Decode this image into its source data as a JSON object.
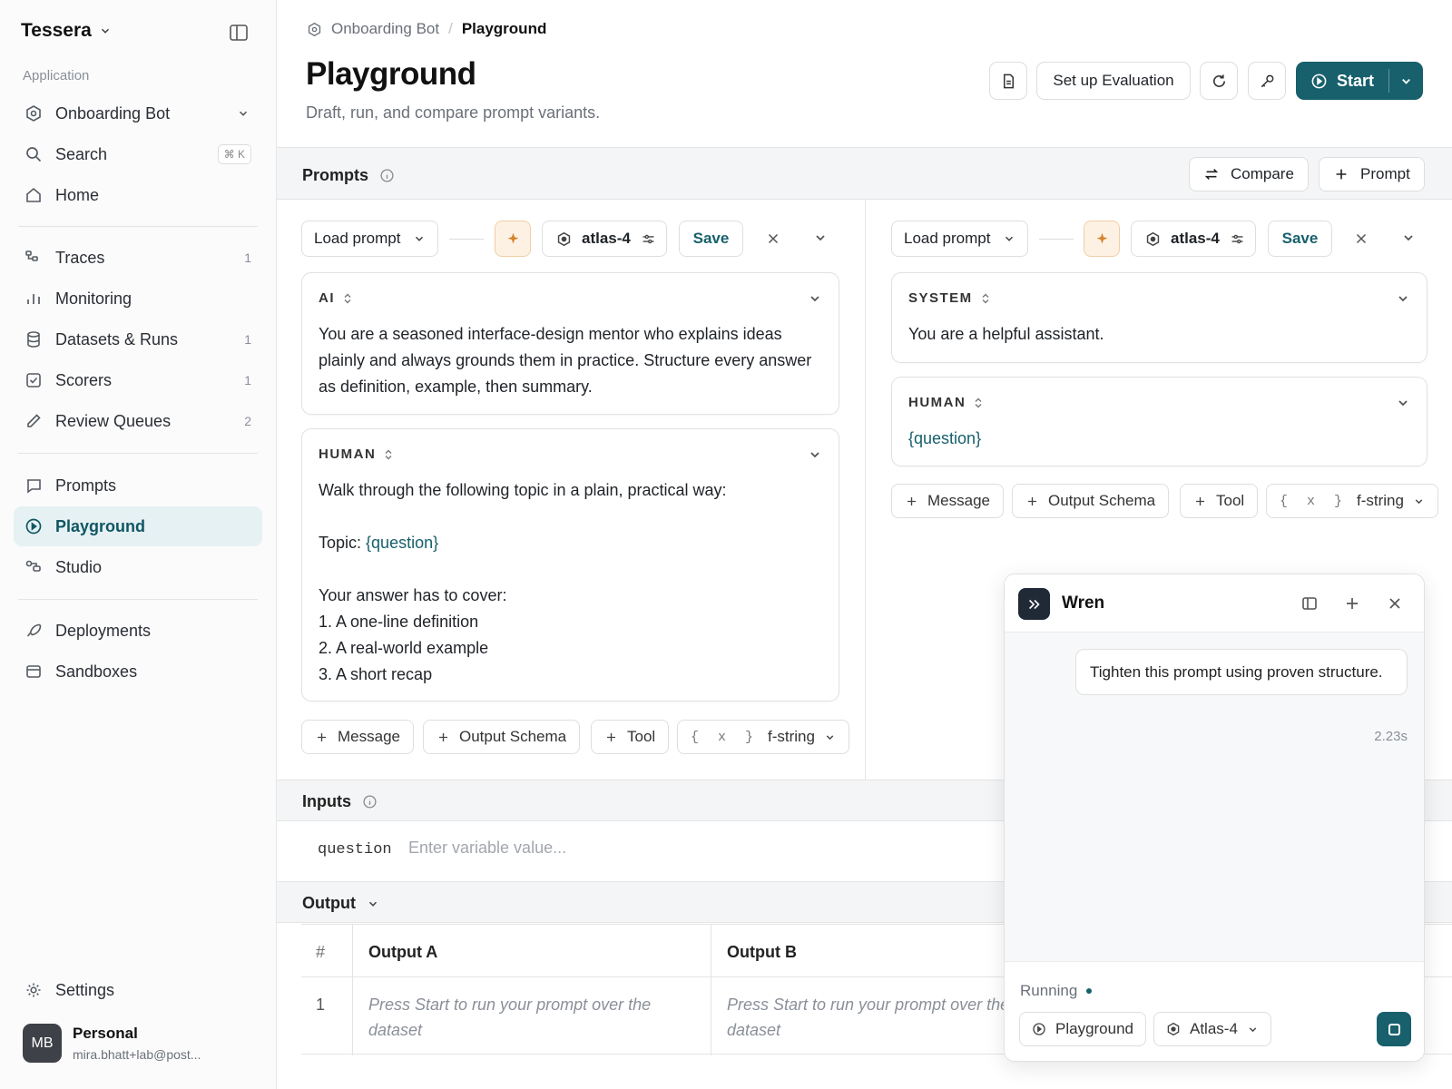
{
  "sidebar": {
    "brand": "Tessera",
    "section_label": "Application",
    "app_selector": "Onboarding Bot",
    "search": {
      "label": "Search",
      "shortcut": "⌘ K"
    },
    "home": "Home",
    "group1": [
      {
        "label": "Traces",
        "count": "1",
        "icon": "traces-icon"
      },
      {
        "label": "Monitoring",
        "count": "",
        "icon": "chart-icon"
      },
      {
        "label": "Datasets & Runs",
        "count": "1",
        "icon": "database-icon"
      },
      {
        "label": "Scorers",
        "count": "1",
        "icon": "check-square-icon"
      },
      {
        "label": "Review Queues",
        "count": "2",
        "icon": "pencil-icon"
      }
    ],
    "group2": [
      {
        "label": "Prompts",
        "icon": "message-icon"
      },
      {
        "label": "Playground",
        "icon": "play-circle-icon",
        "active": true
      },
      {
        "label": "Studio",
        "icon": "studio-icon"
      }
    ],
    "group3": [
      {
        "label": "Deployments",
        "icon": "rocket-icon"
      },
      {
        "label": "Sandboxes",
        "icon": "window-icon"
      }
    ],
    "settings": "Settings",
    "user": {
      "initials": "MB",
      "name": "Personal",
      "email": "mira.bhatt+lab@post..."
    }
  },
  "header": {
    "breadcrumb": [
      "Onboarding Bot",
      "Playground"
    ],
    "title": "Playground",
    "subtitle": "Draft, run, and compare prompt variants.",
    "setup_eval": "Set up Evaluation",
    "start": "Start"
  },
  "prompts": {
    "title": "Prompts",
    "compare": "Compare",
    "add_prompt": "Prompt",
    "columns": [
      {
        "load": "Load prompt",
        "model": "atlas-4",
        "save": "Save",
        "messages": [
          {
            "role": "AI",
            "text": "You are a seasoned interface-design mentor who explains ideas plainly and always grounds them in practice. Structure every answer as definition, example, then summary."
          },
          {
            "role": "HUMAN",
            "line1": "Walk through the following topic in a plain, practical way:",
            "topic_prefix": "Topic: ",
            "topic_var": "{question}",
            "cover": "Your answer has to cover:",
            "item1": "1. A one-line definition",
            "item2": "2. A real-world example",
            "item3": "3. A short recap"
          }
        ]
      },
      {
        "load": "Load prompt",
        "model": "atlas-4",
        "save": "Save",
        "messages": [
          {
            "role": "SYSTEM",
            "text": "You are a helpful assistant."
          },
          {
            "role": "HUMAN",
            "text": "{question}"
          }
        ]
      }
    ],
    "actions": {
      "message": "Message",
      "schema": "Output Schema",
      "tool": "Tool",
      "brace": "{ x }",
      "format": "f-string"
    }
  },
  "inputs": {
    "title": "Inputs",
    "var_name": "question",
    "placeholder": "Enter variable value..."
  },
  "output": {
    "title": "Output",
    "headers": [
      "#",
      "Output A",
      "Output B"
    ],
    "row_index": "1",
    "cell_a": "Press Start to run your prompt over the dataset",
    "cell_b": "Press Start to run your prompt over the dataset"
  },
  "wren": {
    "title": "Wren",
    "user_message": "Tighten this prompt using proven structure.",
    "elapsed": "2.23s",
    "status": "Running",
    "context_chip": "Playground",
    "model_chip": "Atlas-4"
  },
  "colors": {
    "accent": "#17606c",
    "sparkle": "#d5852c"
  }
}
